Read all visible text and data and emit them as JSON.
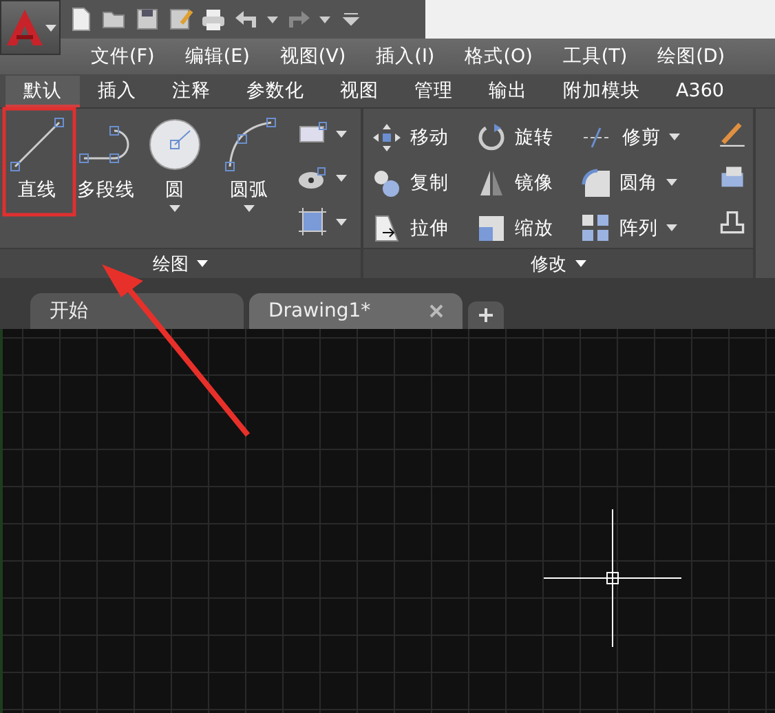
{
  "menu_bar": [
    "文件(F)",
    "编辑(E)",
    "视图(V)",
    "插入(I)",
    "格式(O)",
    "工具(T)",
    "绘图(D)"
  ],
  "ribbon_tabs": [
    {
      "label": "默认",
      "selected": true
    },
    {
      "label": "插入",
      "selected": false
    },
    {
      "label": "注释",
      "selected": false
    },
    {
      "label": "参数化",
      "selected": false
    },
    {
      "label": "视图",
      "selected": false
    },
    {
      "label": "管理",
      "selected": false
    },
    {
      "label": "输出",
      "selected": false
    },
    {
      "label": "附加模块",
      "selected": false
    },
    {
      "label": "A360",
      "selected": false
    }
  ],
  "draw_panel": {
    "title": "绘图",
    "tools": [
      {
        "label": "直线",
        "has_dropdown": false
      },
      {
        "label": "多段线",
        "has_dropdown": false
      },
      {
        "label": "圆",
        "has_dropdown": true
      },
      {
        "label": "圆弧",
        "has_dropdown": true
      }
    ]
  },
  "modify_panel": {
    "title": "修改",
    "tools": [
      {
        "label": "移动",
        "has_dropdown": false
      },
      {
        "label": "旋转",
        "has_dropdown": false
      },
      {
        "label": "修剪",
        "has_dropdown": true
      },
      {
        "label": "复制",
        "has_dropdown": false
      },
      {
        "label": "镜像",
        "has_dropdown": false
      },
      {
        "label": "圆角",
        "has_dropdown": true
      },
      {
        "label": "拉伸",
        "has_dropdown": false
      },
      {
        "label": "缩放",
        "has_dropdown": false
      },
      {
        "label": "阵列",
        "has_dropdown": true
      }
    ]
  },
  "file_tabs": [
    {
      "label": "开始",
      "selected": false,
      "closable": false
    },
    {
      "label": "Drawing1*",
      "selected": true,
      "closable": true
    }
  ]
}
